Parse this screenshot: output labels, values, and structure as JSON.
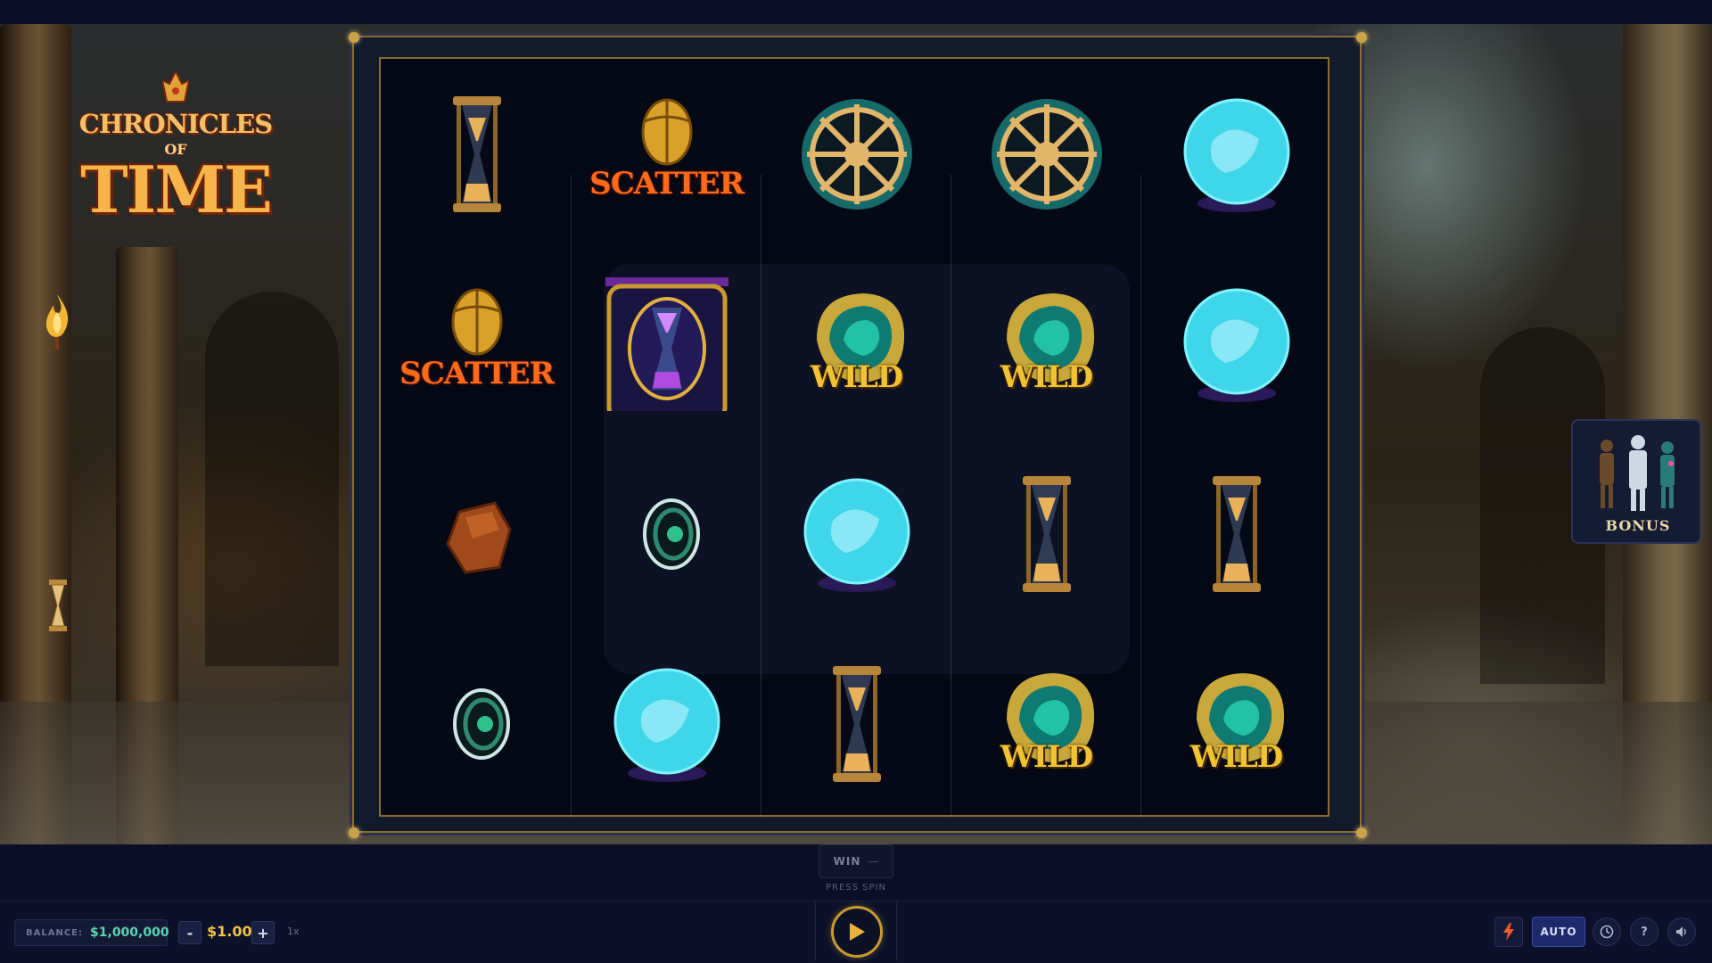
{
  "game": {
    "logo": {
      "line1": "CHRONICLES",
      "line2": "OF",
      "line3": "TIME"
    },
    "bonus_label": "BONUS"
  },
  "reels": [
    [
      "hourglass",
      "scatter",
      "stone",
      "gem-ring"
    ],
    [
      "scarab-scatter",
      "hourglass-shrine",
      "gem-ring",
      "crystal-ball"
    ],
    [
      "ship-wheel",
      "wild",
      "crystal-ball",
      "hourglass"
    ],
    [
      "ship-wheel",
      "wild",
      "hourglass",
      "wild"
    ],
    [
      "crystal-ball",
      "crystal-ball",
      "hourglass",
      "wild"
    ]
  ],
  "symbol_labels": {
    "scatter": "SCATTER",
    "wild": "WILD"
  },
  "win": {
    "label": "WIN",
    "value": "—"
  },
  "press_spin": "PRESS SPIN",
  "bottom_bar": {
    "balance_label": "BALANCE:",
    "balance_value": "$1,000,000",
    "bet_minus": "-",
    "bet_value": "$1.00",
    "bet_plus": "+",
    "multiplier": "1x",
    "auto_label": "AUTO",
    "help_label": "?"
  },
  "colors": {
    "accent_gold": "#c99a2e",
    "balance_green": "#57d6b4",
    "scatter_orange": "#ff6a1a",
    "wild_gold": "#f1c232",
    "auto_blue": "#1c2a6b"
  },
  "icons": [
    "spin-play-icon",
    "turbo-lightning-icon",
    "history-clock-icon",
    "sound-speaker-icon"
  ]
}
